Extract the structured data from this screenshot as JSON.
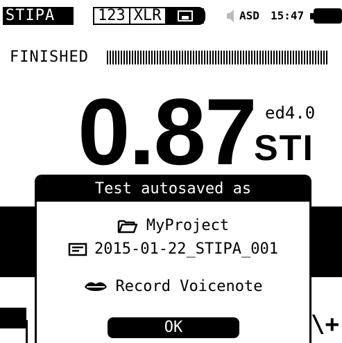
{
  "status_bar": {
    "mode": "STIPA",
    "tabs": [
      "123",
      "XLR"
    ],
    "save_icon": "save-icon",
    "speaker_icon": "speaker-icon",
    "indicator": "ASD",
    "time": "15:47",
    "battery_icon": "battery-icon"
  },
  "measurement": {
    "status": "FINISHED",
    "progress": 1.0,
    "value": "0.87",
    "unit": "STI",
    "standard": "ed4.0"
  },
  "dialog": {
    "title": "Test autosaved as",
    "project": "MyProject",
    "project_icon": "folder-open-icon",
    "filename": "2015-01-22_STIPA_001",
    "filename_icon": "file-icon",
    "voicenote": "Record Voicenote",
    "voicenote_icon": "lips-icon",
    "ok_label": "OK"
  }
}
